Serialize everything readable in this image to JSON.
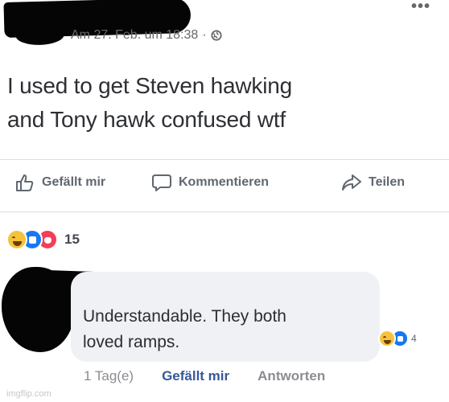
{
  "post": {
    "author_name": "",
    "timestamp": "Am 27. Feb. um 18:38",
    "separator": "·",
    "privacy_icon": "globe-icon",
    "more_label": "•••",
    "text_line1": "I used to get Steven hawking",
    "text_line2": "and Tony hawk confused wtf"
  },
  "actions": {
    "like_label": "Gefällt mir",
    "comment_label": "Kommentieren",
    "share_label": "Teilen"
  },
  "reactions": {
    "types": [
      "haha",
      "like",
      "love"
    ],
    "count": "15"
  },
  "comment": {
    "author_name": "",
    "text_line1": "Understandable. They both",
    "text_line2": "loved ramps.",
    "reaction_types": [
      "haha",
      "like"
    ],
    "reaction_count": "4",
    "time_label": "1 Tag(e)",
    "like_label": "Gefällt mir",
    "reply_label": "Antworten"
  },
  "watermark": "imgflip.com",
  "colors": {
    "accent": "#365899",
    "like_blue": "#1877f2",
    "love_red": "#f33e58",
    "haha_yellow": "#f5c33b",
    "bubble_bg": "#eff1f4"
  }
}
